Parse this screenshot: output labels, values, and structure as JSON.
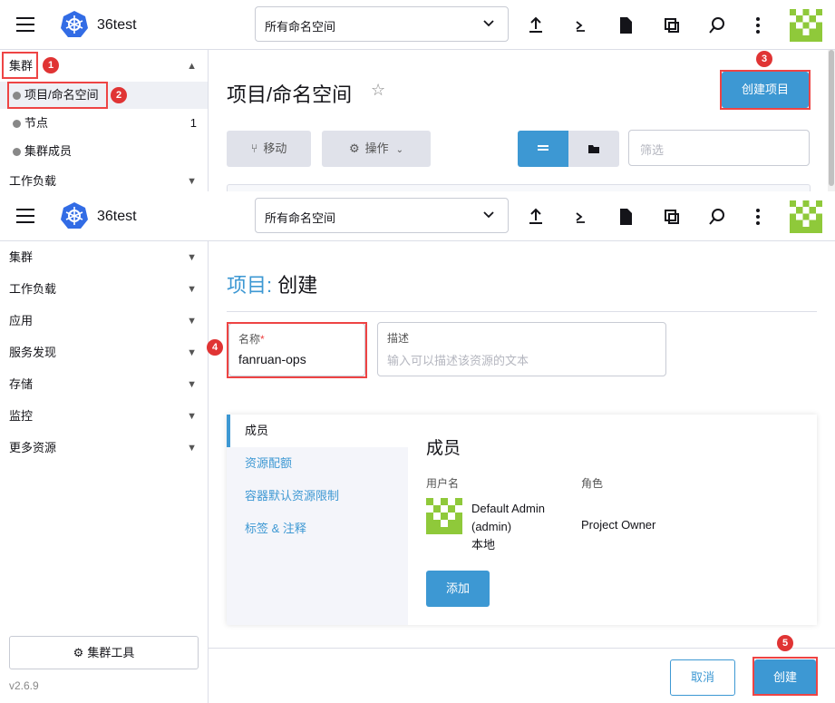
{
  "header": {
    "brand": "36test",
    "namespace_select": "所有命名空间"
  },
  "top": {
    "sidebar": {
      "group": "集群",
      "items": [
        {
          "label": "项目/命名空间",
          "count": ""
        },
        {
          "label": "节点",
          "count": "1"
        },
        {
          "label": "集群成员",
          "count": ""
        }
      ],
      "workload": "工作负载"
    },
    "page_title": "项目/命名空间",
    "create_project_label": "创建项目",
    "move_label": "移动",
    "actions_label": "操作",
    "filter_placeholder": "筛选"
  },
  "bottom": {
    "sidebar": {
      "groups": [
        "集群",
        "工作负载",
        "应用",
        "服务发现",
        "存储",
        "监控",
        "更多资源"
      ],
      "cluster_tools": "集群工具",
      "version": "v2.6.9"
    },
    "title_prefix": "项目:",
    "title_suffix": "创建",
    "name_label": "名称",
    "name_value": "fanruan-ops",
    "desc_label": "描述",
    "desc_placeholder": "输入可以描述该资源的文本",
    "tabs": [
      "成员",
      "资源配额",
      "容器默认资源限制",
      "标签 & 注释"
    ],
    "members_title": "成员",
    "col_user": "用户名",
    "col_role": "角色",
    "member": {
      "name": "Default Admin",
      "login": "(admin)",
      "source": "本地",
      "role": "Project Owner"
    },
    "add_label": "添加",
    "cancel_label": "取消",
    "create_label": "创建"
  },
  "annotations": [
    "1",
    "2",
    "3",
    "4",
    "5"
  ],
  "colors": {
    "primary": "#3d98d3",
    "annotation": "#e03434",
    "avatar": "#8fc93a"
  }
}
